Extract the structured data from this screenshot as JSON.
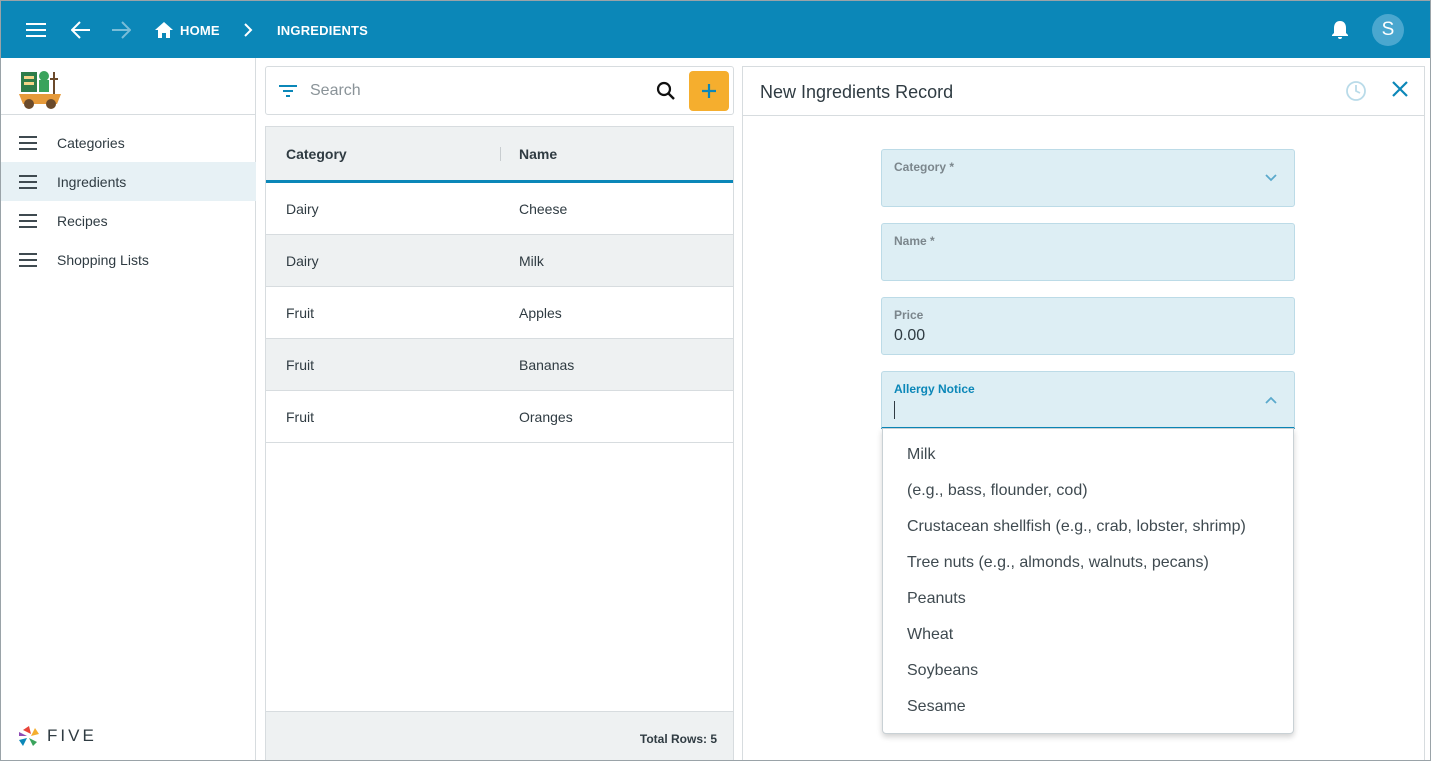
{
  "topbar": {
    "breadcrumb_home": "HOME",
    "breadcrumb_current": "INGREDIENTS",
    "avatar_initial": "S",
    "brand_color": "#0b87b8"
  },
  "sidebar": {
    "items": [
      {
        "label": "Categories",
        "active": false
      },
      {
        "label": "Ingredients",
        "active": true
      },
      {
        "label": "Recipes",
        "active": false
      },
      {
        "label": "Shopping Lists",
        "active": false
      }
    ],
    "footer_brand": "FIVE"
  },
  "list": {
    "search_placeholder": "Search",
    "columns": [
      "Category",
      "Name"
    ],
    "rows": [
      {
        "category": "Dairy",
        "name": "Cheese"
      },
      {
        "category": "Dairy",
        "name": "Milk"
      },
      {
        "category": "Fruit",
        "name": "Apples"
      },
      {
        "category": "Fruit",
        "name": "Bananas"
      },
      {
        "category": "Fruit",
        "name": "Oranges"
      }
    ],
    "total_rows": "Total Rows: 5",
    "add_button_color": "#f5ae2e"
  },
  "form": {
    "title": "New Ingredients Record",
    "fields": {
      "category": {
        "label": "Category *",
        "value": ""
      },
      "name": {
        "label": "Name *",
        "value": ""
      },
      "price": {
        "label": "Price",
        "value": "0.00"
      },
      "allergy": {
        "label": "Allergy Notice",
        "value": ""
      }
    },
    "allergy_options": [
      "Milk",
      "(e.g., bass, flounder, cod)",
      "Crustacean shellfish (e.g., crab, lobster, shrimp)",
      "Tree nuts (e.g., almonds, walnuts, pecans)",
      "Peanuts",
      "Wheat",
      "Soybeans",
      "Sesame"
    ]
  },
  "icons": {
    "menu": "menu-icon",
    "back": "arrow-back-icon",
    "forward": "arrow-forward-icon",
    "home": "home-icon",
    "bell": "bell-icon",
    "filter": "filter-icon",
    "search": "search-icon",
    "add": "plus-icon",
    "history": "history-icon",
    "close": "close-icon"
  }
}
